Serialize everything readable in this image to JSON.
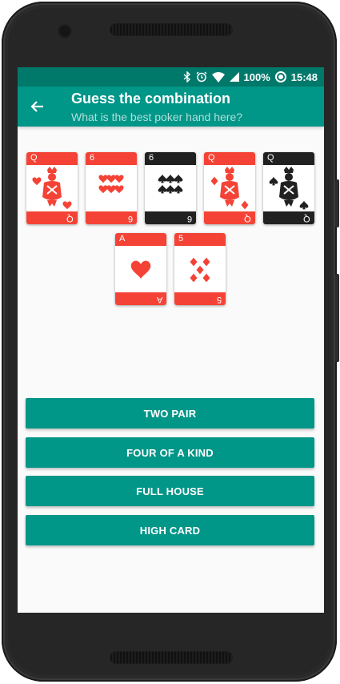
{
  "status": {
    "battery": "100%",
    "time": "15:48"
  },
  "header": {
    "title": "Guess the combination",
    "subtitle": "What is the best poker hand here?"
  },
  "cards": [
    {
      "rank": "Q",
      "suit": "hearts",
      "color": "red"
    },
    {
      "rank": "6",
      "suit": "hearts",
      "color": "red"
    },
    {
      "rank": "6",
      "suit": "spades",
      "color": "black"
    },
    {
      "rank": "Q",
      "suit": "diamonds",
      "color": "red"
    },
    {
      "rank": "Q",
      "suit": "spades",
      "color": "black"
    },
    {
      "rank": "A",
      "suit": "hearts",
      "color": "red"
    },
    {
      "rank": "5",
      "suit": "diamonds",
      "color": "red"
    }
  ],
  "answers": [
    "TWO PAIR",
    "FOUR OF A KIND",
    "FULL HOUSE",
    "HIGH CARD"
  ],
  "colors": {
    "primary": "#009688",
    "primary_dark": "#00796b",
    "card_red": "#f44336",
    "card_black": "#212121"
  }
}
